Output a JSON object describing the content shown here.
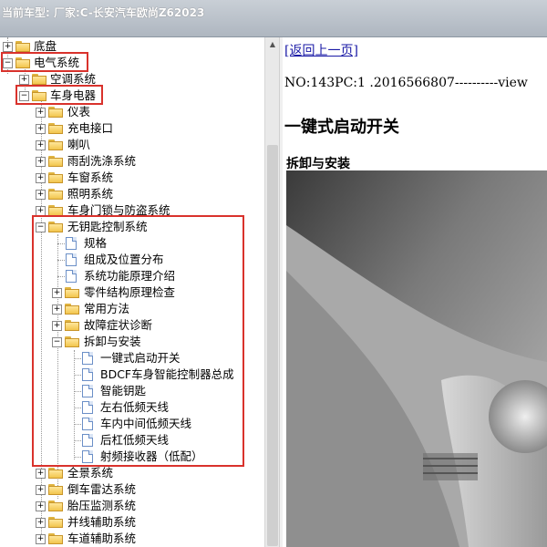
{
  "window": {
    "title": "当前车型:  厂家:C-长安汽车欧尚Z62023"
  },
  "tree": {
    "items": [
      {
        "label": "底盘",
        "box": "+",
        "icon": "folder"
      },
      {
        "label": "电气系统",
        "box": "−",
        "icon": "folder-open"
      },
      {
        "label": "空调系统",
        "box": "+",
        "icon": "folder"
      },
      {
        "label": "车身电器",
        "box": "−",
        "icon": "folder-open"
      },
      {
        "label": "仪表",
        "box": "+",
        "icon": "folder"
      },
      {
        "label": "充电接口",
        "box": "+",
        "icon": "folder"
      },
      {
        "label": "喇叭",
        "box": "+",
        "icon": "folder"
      },
      {
        "label": "雨刮洗涤系统",
        "box": "+",
        "icon": "folder"
      },
      {
        "label": "车窗系统",
        "box": "+",
        "icon": "folder"
      },
      {
        "label": "照明系统",
        "box": "+",
        "icon": "folder"
      },
      {
        "label": "车身门锁与防盗系统",
        "box": "+",
        "icon": "folder"
      },
      {
        "label": "无钥匙控制系统",
        "box": "−",
        "icon": "folder-open"
      },
      {
        "label": "规格",
        "box": "",
        "icon": "document"
      },
      {
        "label": "组成及位置分布",
        "box": "",
        "icon": "document"
      },
      {
        "label": "系统功能原理介绍",
        "box": "",
        "icon": "document"
      },
      {
        "label": "零件结构原理检查",
        "box": "+",
        "icon": "folder"
      },
      {
        "label": "常用方法",
        "box": "+",
        "icon": "folder"
      },
      {
        "label": "故障症状诊断",
        "box": "+",
        "icon": "folder"
      },
      {
        "label": "拆卸与安装",
        "box": "−",
        "icon": "folder-open"
      },
      {
        "label": "一键式启动开关",
        "box": "",
        "icon": "document"
      },
      {
        "label": "BDCF车身智能控制器总成",
        "box": "",
        "icon": "document"
      },
      {
        "label": "智能钥匙",
        "box": "",
        "icon": "document"
      },
      {
        "label": "左右低频天线",
        "box": "",
        "icon": "document"
      },
      {
        "label": "车内中间低频天线",
        "box": "",
        "icon": "document"
      },
      {
        "label": "后杠低频天线",
        "box": "",
        "icon": "document"
      },
      {
        "label": "射频接收器（低配）",
        "box": "",
        "icon": "document"
      },
      {
        "label": "全景系统",
        "box": "+",
        "icon": "folder"
      },
      {
        "label": "倒车雷达系统",
        "box": "+",
        "icon": "folder"
      },
      {
        "label": "胎压监测系统",
        "box": "+",
        "icon": "folder"
      },
      {
        "label": "并线辅助系统",
        "box": "+",
        "icon": "folder"
      },
      {
        "label": "车道辅助系统",
        "box": "+",
        "icon": "folder"
      }
    ]
  },
  "content": {
    "back_link": "[返回上一页]",
    "doc_meta": "NO:143PC:1 .2016566807----------view",
    "title": "一键式启动开关",
    "section": "拆卸与安装"
  },
  "colors": {
    "highlight_border": "#d9322c",
    "link": "#1a1aa6"
  }
}
